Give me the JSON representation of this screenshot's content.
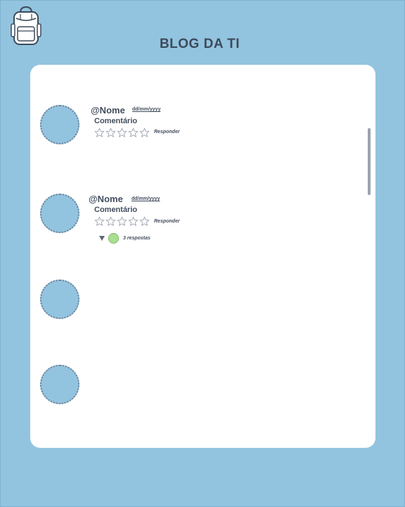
{
  "header": {
    "title": "BLOG DA TI",
    "logo_icon": "backpack-icon"
  },
  "comments": [
    {
      "name": "@Nome",
      "date": "dd/mm/yyyy",
      "text": "Comentário",
      "rating": 0,
      "reply_label": "Responder",
      "replies_label": ""
    },
    {
      "name": "@Nome",
      "date": "dd/mm/yyyy",
      "text": "Comentário",
      "rating": 0,
      "reply_label": "Responder",
      "replies_label": "3 respostas"
    }
  ],
  "colors": {
    "background": "#93c4df",
    "card": "#ffffff",
    "text": "#434e5e",
    "reply_avatar": "#a8e08f"
  }
}
